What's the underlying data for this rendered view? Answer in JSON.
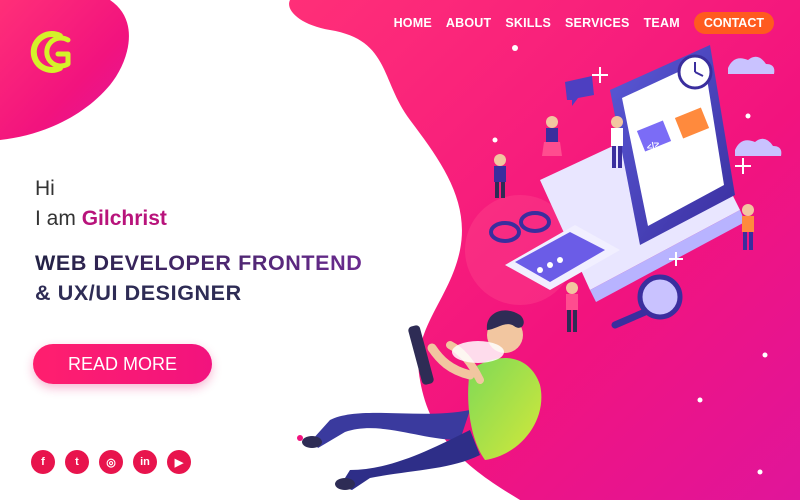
{
  "brand": {
    "logo_icon": "cg-logo-icon"
  },
  "nav": {
    "items": [
      {
        "label": "HOME"
      },
      {
        "label": "ABOUT"
      },
      {
        "label": "SKILLS"
      },
      {
        "label": "SERVICES"
      },
      {
        "label": "TEAM"
      }
    ],
    "cta_label": "CONTACT"
  },
  "hero": {
    "greeting": "Hi",
    "intro": "I am",
    "name": "Gilchrist",
    "title_line1": "WEB DEVELOPER FRONTEND",
    "title_line2": "& UX/UI DESIGNER",
    "button_label": "READ MORE"
  },
  "social": [
    {
      "icon": "facebook-icon",
      "glyph": "f"
    },
    {
      "icon": "twitter-icon",
      "glyph": "t"
    },
    {
      "icon": "instagram-icon",
      "glyph": "◎"
    },
    {
      "icon": "linkedin-icon",
      "glyph": "in"
    },
    {
      "icon": "youtube-icon",
      "glyph": "▶"
    }
  ],
  "colors": {
    "accent": "#f2137e",
    "cta": "#ff5a1f",
    "name": "#b8137b",
    "blob": "#ff1f6e"
  }
}
